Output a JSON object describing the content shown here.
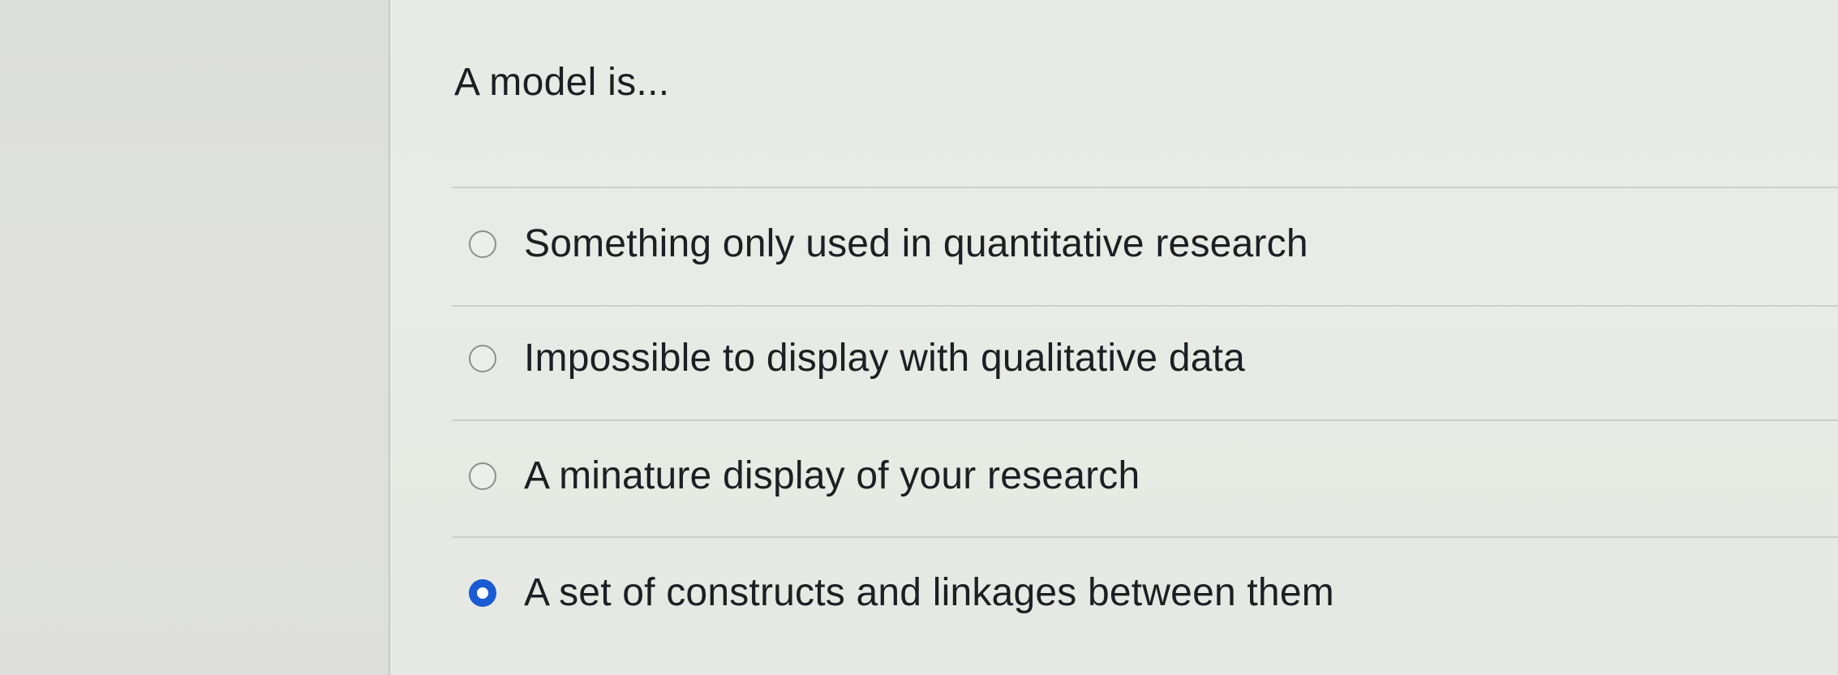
{
  "quiz": {
    "question": "A model is...",
    "options": [
      {
        "label": "Something only used in quantitative research",
        "selected": false
      },
      {
        "label": "Impossible to display with qualitative data",
        "selected": false
      },
      {
        "label": "A minature display of your research",
        "selected": false
      },
      {
        "label": "A set of constructs and linkages between them",
        "selected": true
      }
    ]
  },
  "colors": {
    "accent": "#1a5bd3",
    "text": "#1e1f22",
    "divider": "#cdcfcc"
  }
}
